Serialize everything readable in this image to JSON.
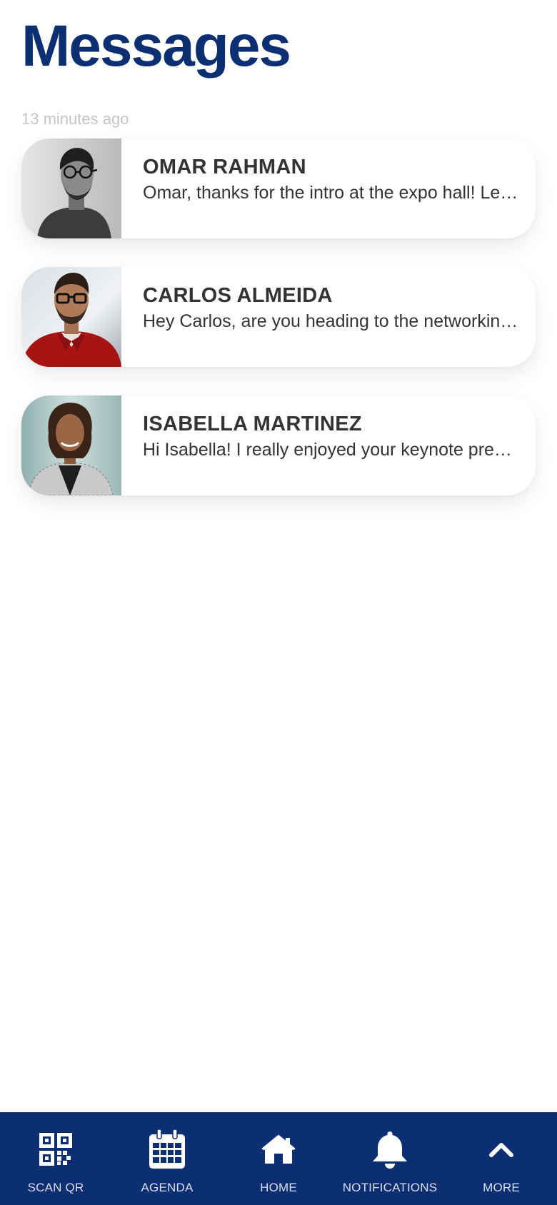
{
  "header": {
    "title": "Messages"
  },
  "timestamp": "13 minutes ago",
  "messages": [
    {
      "name": "OMAR RAHMAN",
      "preview": "Omar, thanks for the intro at the expo hall! Le…",
      "avatar": "person-photo-grayscale"
    },
    {
      "name": "CARLOS ALMEIDA",
      "preview": "Hey Carlos, are you heading to the networkin…",
      "avatar": "person-photo-red-shirt"
    },
    {
      "name": "ISABELLA MARTINEZ",
      "preview": "Hi Isabella! I really enjoyed your keynote pre…",
      "avatar": "person-photo-blazer"
    }
  ],
  "tabbar": {
    "items": [
      {
        "label": "SCAN QR",
        "icon": "qr-code-icon"
      },
      {
        "label": "AGENDA",
        "icon": "calendar-icon"
      },
      {
        "label": "HOME",
        "icon": "home-icon"
      },
      {
        "label": "NOTIFICATIONS",
        "icon": "bell-icon"
      },
      {
        "label": "MORE",
        "icon": "chevron-up-icon"
      }
    ]
  },
  "colors": {
    "brand": "#0c2f73",
    "text": "#333333",
    "muted": "#c4c4c4",
    "tab_label": "#d9deea"
  }
}
